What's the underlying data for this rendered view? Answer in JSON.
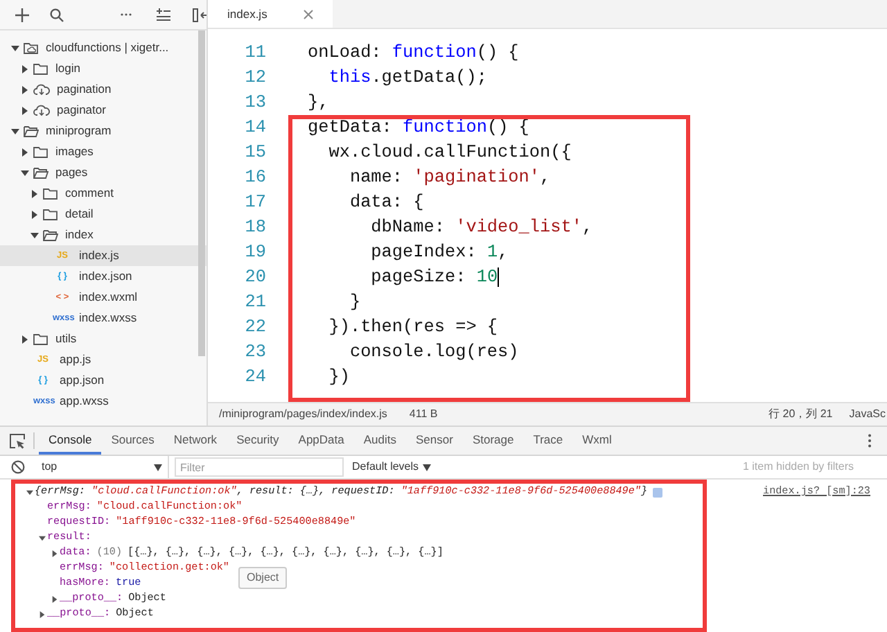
{
  "sidebar": {
    "tree": [
      {
        "label": "cloudfunctions | xigetr...",
        "kind": "cloud-root",
        "expanded": true,
        "selected": false,
        "children": [
          {
            "label": "login",
            "kind": "folder",
            "expanded": false,
            "selected": false
          },
          {
            "label": "pagination",
            "kind": "cloud",
            "expanded": false,
            "selected": false
          },
          {
            "label": "paginator",
            "kind": "cloud",
            "expanded": false,
            "selected": false
          }
        ]
      },
      {
        "label": "miniprogram",
        "kind": "folder",
        "expanded": true,
        "selected": false,
        "children": [
          {
            "label": "images",
            "kind": "folder",
            "expanded": false,
            "selected": false
          },
          {
            "label": "pages",
            "kind": "folder",
            "expanded": true,
            "selected": false,
            "children": [
              {
                "label": "comment",
                "kind": "folder",
                "expanded": false,
                "selected": false
              },
              {
                "label": "detail",
                "kind": "folder",
                "expanded": false,
                "selected": false
              },
              {
                "label": "index",
                "kind": "folder",
                "expanded": true,
                "selected": false,
                "children": [
                  {
                    "label": "index.js",
                    "kind": "js",
                    "icon": "JS",
                    "selected": true
                  },
                  {
                    "label": "index.json",
                    "kind": "json",
                    "icon": "{ }",
                    "selected": false
                  },
                  {
                    "label": "index.wxml",
                    "kind": "wxml",
                    "icon": "< >",
                    "selected": false
                  },
                  {
                    "label": "index.wxss",
                    "kind": "wxss",
                    "icon": "wxss",
                    "selected": false
                  }
                ]
              }
            ]
          },
          {
            "label": "utils",
            "kind": "folder",
            "expanded": false,
            "selected": false
          },
          {
            "label": "app.js",
            "kind": "js",
            "icon": "JS",
            "selected": false
          },
          {
            "label": "app.json",
            "kind": "json",
            "icon": "{ }",
            "selected": false
          },
          {
            "label": "app.wxss",
            "kind": "wxss",
            "icon": "wxss",
            "selected": false
          }
        ]
      }
    ]
  },
  "editor": {
    "tabs": [
      {
        "label": "index.js",
        "selected": true
      }
    ],
    "lines": [
      {
        "number": "11",
        "cursor": false,
        "tokens": [
          {
            "kind": "plain",
            "text": "onLoad: "
          },
          {
            "kind": "keyword",
            "text": "function"
          },
          {
            "kind": "plain",
            "text": "() {"
          }
        ]
      },
      {
        "number": "12",
        "cursor": false,
        "tokens": [
          {
            "kind": "keyword",
            "text": "  this"
          },
          {
            "kind": "plain",
            "text": ".getData();"
          }
        ]
      },
      {
        "number": "13",
        "cursor": false,
        "tokens": [
          {
            "kind": "plain",
            "text": "},"
          }
        ]
      },
      {
        "number": "14",
        "cursor": false,
        "tokens": [
          {
            "kind": "plain",
            "text": "getData: "
          },
          {
            "kind": "keyword",
            "text": "function"
          },
          {
            "kind": "plain",
            "text": "() {"
          }
        ]
      },
      {
        "number": "15",
        "cursor": false,
        "tokens": [
          {
            "kind": "plain",
            "text": "  wx.cloud.callFunction({"
          }
        ]
      },
      {
        "number": "16",
        "cursor": false,
        "tokens": [
          {
            "kind": "plain",
            "text": "    name: "
          },
          {
            "kind": "string",
            "text": "'pagination'"
          },
          {
            "kind": "plain",
            "text": ","
          }
        ]
      },
      {
        "number": "17",
        "cursor": false,
        "tokens": [
          {
            "kind": "plain",
            "text": "    data: {"
          }
        ]
      },
      {
        "number": "18",
        "cursor": false,
        "tokens": [
          {
            "kind": "plain",
            "text": "      dbName: "
          },
          {
            "kind": "string",
            "text": "'video_list'"
          },
          {
            "kind": "plain",
            "text": ","
          }
        ]
      },
      {
        "number": "19",
        "cursor": false,
        "tokens": [
          {
            "kind": "plain",
            "text": "      pageIndex: "
          },
          {
            "kind": "number",
            "text": "1"
          },
          {
            "kind": "plain",
            "text": ","
          }
        ]
      },
      {
        "number": "20",
        "cursor": true,
        "tokens": [
          {
            "kind": "plain",
            "text": "      pageSize: "
          },
          {
            "kind": "number",
            "text": "10"
          }
        ]
      },
      {
        "number": "21",
        "cursor": false,
        "tokens": [
          {
            "kind": "plain",
            "text": "    }"
          }
        ]
      },
      {
        "number": "22",
        "cursor": false,
        "tokens": [
          {
            "kind": "plain",
            "text": "  }).then(res => {"
          }
        ]
      },
      {
        "number": "23",
        "cursor": false,
        "tokens": [
          {
            "kind": "plain",
            "text": "    console.log(res)"
          }
        ]
      },
      {
        "number": "24",
        "cursor": false,
        "tokens": [
          {
            "kind": "plain",
            "text": "  })"
          }
        ]
      }
    ],
    "status_bar": {
      "path": "/miniprogram/pages/index/index.js",
      "size": "411 B",
      "position": "行 20，列 21",
      "language": "JavaSc"
    }
  },
  "devtools": {
    "tabs": [
      {
        "label": "Console",
        "selected": true
      },
      {
        "label": "Sources",
        "selected": false
      },
      {
        "label": "Network",
        "selected": false
      },
      {
        "label": "Security",
        "selected": false
      },
      {
        "label": "AppData",
        "selected": false
      },
      {
        "label": "Audits",
        "selected": false
      },
      {
        "label": "Sensor",
        "selected": false
      },
      {
        "label": "Storage",
        "selected": false
      },
      {
        "label": "Trace",
        "selected": false
      },
      {
        "label": "Wxml",
        "selected": false
      }
    ],
    "toolbar": {
      "context": "top",
      "filter_placeholder": "Filter",
      "levels": "Default levels",
      "hidden_note": "1 item hidden by filters"
    },
    "console": {
      "entries": [
        {
          "expanded": true,
          "link": "index.js? [sm]:23",
          "summary": [
            {
              "kind": "plain",
              "text": "{errMsg: "
            },
            {
              "kind": "string",
              "text": "\"cloud.callFunction:ok\""
            },
            {
              "kind": "plain",
              "text": ", result: {…}, requestID: "
            },
            {
              "kind": "string",
              "text": "\"1aff910c-c332-11e8-9f6d-525400e8849e\""
            },
            {
              "kind": "plain",
              "text": "}"
            }
          ],
          "properties": [
            {
              "key": "errMsg:",
              "value": "\"cloud.callFunction:ok\"",
              "kind": "string"
            },
            {
              "key": "requestID:",
              "value": "\"1aff910c-c332-11e8-9f6d-525400e8849e\"",
              "kind": "string"
            },
            {
              "key": "result:",
              "expanded": true,
              "children": [
                {
                  "key": "data:",
                  "expanded": false,
                  "count": "(10)",
                  "value": "[{…}, {…}, {…}, {…}, {…}, {…}, {…}, {…}, {…}, {…}]",
                  "kind": "plain"
                },
                {
                  "key": "errMsg:",
                  "value": "\"collection.get:ok\"",
                  "kind": "string"
                },
                {
                  "key": "hasMore:",
                  "value": "true",
                  "kind": "boolean"
                },
                {
                  "key": "__proto__:",
                  "expanded": false,
                  "value": "Object",
                  "kind": "plain"
                }
              ]
            },
            {
              "key": "__proto__:",
              "expanded": false,
              "value": "Object",
              "kind": "plain"
            }
          ]
        }
      ],
      "tooltip": "Object"
    }
  }
}
